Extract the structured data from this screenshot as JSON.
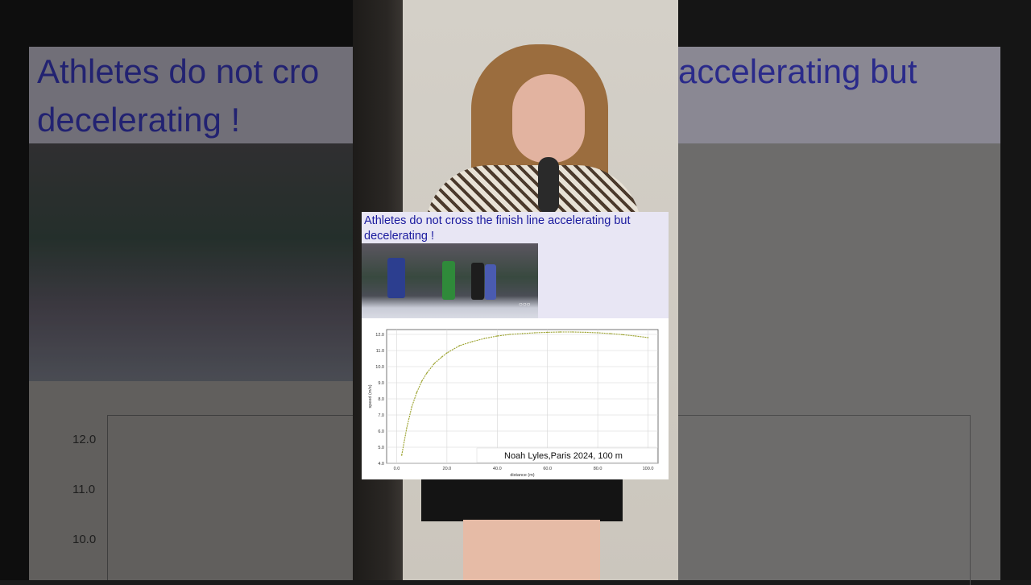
{
  "slide": {
    "title": "Athletes do not cross the finish line accelerating but decelerating !",
    "bg_title_left": "Athletes do not cro",
    "bg_title_left_2": "decelerating !",
    "bg_title_right": "accelerating but",
    "olympic_rings": "○○○"
  },
  "background_ticks": [
    "12.0",
    "11.0",
    "10.0"
  ],
  "colors": {
    "title_text": "#1a1a9e",
    "title_band": "#e8e6f4",
    "curve": "#9aa12b",
    "grid": "#d6d6d6"
  },
  "chart_data": {
    "type": "line",
    "title": "",
    "xlabel": "distance (m)",
    "ylabel": "speed (m/s)",
    "xlim": [
      -4,
      104
    ],
    "ylim": [
      4.0,
      12.3
    ],
    "xticks": [
      "0.0",
      "20.0",
      "40.0",
      "60.0",
      "80.0",
      "100.0"
    ],
    "yticks": [
      "4.0",
      "5.0",
      "6.0",
      "7.0",
      "8.0",
      "9.0",
      "10.0",
      "11.0",
      "12.0"
    ],
    "grid": true,
    "legend": "bottom-right",
    "series": [
      {
        "name": "Noah Lyles,Paris 2024, 100 m",
        "x": [
          2,
          4,
          6,
          8,
          10,
          12,
          15,
          18,
          20,
          25,
          30,
          35,
          40,
          45,
          50,
          55,
          60,
          65,
          70,
          75,
          80,
          85,
          90,
          95,
          100
        ],
        "y": [
          4.5,
          6.2,
          7.5,
          8.4,
          9.1,
          9.6,
          10.2,
          10.6,
          10.85,
          11.3,
          11.55,
          11.75,
          11.9,
          12.0,
          12.05,
          12.1,
          12.13,
          12.15,
          12.15,
          12.13,
          12.1,
          12.05,
          11.98,
          11.9,
          11.8
        ]
      }
    ]
  }
}
